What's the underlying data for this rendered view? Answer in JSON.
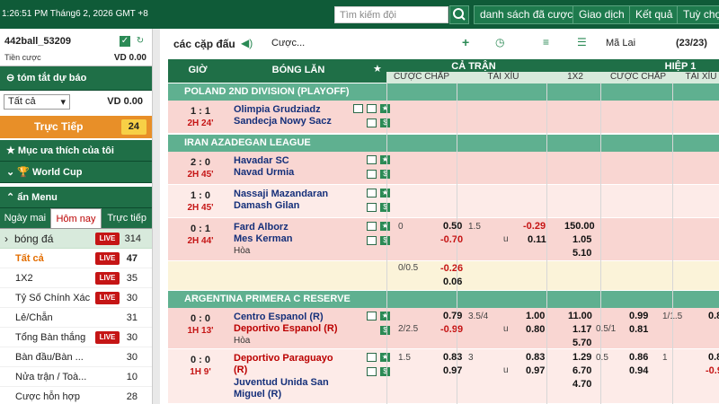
{
  "topbar": {
    "time": "1:26:51 PM Tháng6 2, 2026 GMT +8",
    "search_placeholder": "Tìm kiếm đội",
    "nav": [
      "danh sách đã cược",
      "Giao dịch",
      "Kết quả",
      "Tuỳ chọn"
    ]
  },
  "account": {
    "username": "442ball_53209",
    "bet_label": "Tiền cược",
    "bet_value": "VD  0.00"
  },
  "sidebar": {
    "summary_title": "tóm tắt dự báo",
    "select_value": "Tất cả",
    "summary_value": "VD 0.00",
    "live_label": "Trực Tiếp",
    "live_count": "24",
    "favorites": "Mục ưa thích của tôi",
    "worldcup": "World Cup",
    "hide_menu": "ẩn Menu",
    "tabs": [
      "Ngày mai",
      "Hôm nay",
      "Trực tiếp"
    ],
    "sport": {
      "label": "bóng đá",
      "badge": "LIVE",
      "count": "314"
    },
    "items": [
      {
        "label": "Tất cả",
        "badge": "LIVE",
        "count": "47",
        "active": true
      },
      {
        "label": "1X2",
        "badge": "LIVE",
        "count": "35"
      },
      {
        "label": "Tỷ Số Chính Xác",
        "badge": "LIVE",
        "count": "30"
      },
      {
        "label": "Lẻ/Chẵn",
        "badge": "",
        "count": "31"
      },
      {
        "label": "Tổng Bàn thắng",
        "badge": "LIVE",
        "count": "30"
      },
      {
        "label": "Bàn đầu/Bàn ...",
        "badge": "",
        "count": "30"
      },
      {
        "label": "Nửa trận / Toà...",
        "badge": "",
        "count": "10"
      },
      {
        "label": "Cược hỗn hợp",
        "badge": "",
        "count": "28"
      }
    ]
  },
  "main": {
    "title": "các cặp đấu",
    "bet_label": "Cược...",
    "odds_type": "Mã Lai",
    "count": "(23/23)",
    "columns": {
      "time": "GIỜ",
      "match": "BÓNG LĂN",
      "full_time": "CẢ TRẬN",
      "first_half": "HIỆP 1",
      "handicap": "CƯỢC CHẤP",
      "over_under": "TÀI XỈU",
      "one_x_two": "1X2",
      "handicap2": "CƯỢC CHẤP",
      "over_under2": "TÀI XỈU"
    },
    "leagues": [
      {
        "name": "POLAND 2ND DIVISION (PLAYOFF)"
      },
      {
        "name": "IRAN AZADEGAN LEAGUE"
      },
      {
        "name": "ARGENTINA PRIMERA C RESERVE"
      }
    ],
    "matches": [
      {
        "score": "1 : 1",
        "min": "2H 24'",
        "home": "Olimpia Grudziadz",
        "away": "Sandecja Nowy Sacz"
      },
      {
        "score": "2 : 0",
        "min": "2H 45'",
        "home": "Havadar SC",
        "away": "Navad Urmia"
      },
      {
        "score": "1 : 0",
        "min": "2H 45'",
        "home": "Nassaji Mazandaran",
        "away": "Damash Gilan"
      },
      {
        "score": "0 : 1",
        "min": "2H 44'",
        "home": "Fard Alborz",
        "away": "Mes Kerman",
        "draw": "Hòa",
        "hcap": "0",
        "hcap_home": "0.50",
        "hcap_away": "-0.70",
        "ou": "1.5",
        "ou_u": "u",
        "ou_o": "-0.29",
        "ou_u_val": "0.11",
        "x1": "150.00",
        "x2": "1.05",
        "x3": "5.10",
        "hcap2": "0/0.5",
        "hcap2_home": "-0.26",
        "hcap2_away": "0.06"
      },
      {
        "score": "0 : 0",
        "min": "1H 13'",
        "home": "Centro Espanol (R)",
        "away": "Deportivo Espanol (R)",
        "draw": "Hòa",
        "hcap": "2/2.5",
        "hcap_home": "0.79",
        "hcap_away": "-0.99",
        "ou": "3.5/4",
        "ou_u": "u",
        "ou_o": "1.00",
        "ou_u_val": "0.80",
        "x1": "11.00",
        "x2": "1.17",
        "x3": "5.70",
        "h1_hcap": "0.5/1",
        "h1_home": "0.99",
        "h1_away": "0.81",
        "h1_ou": "1/1.5",
        "h1_o": "0.8"
      },
      {
        "score": "0 : 0",
        "min": "1H 9'",
        "home": "Deportivo Paraguayo (R)",
        "away": "Juventud Unida San Miguel (R)",
        "hcap": "1.5",
        "hcap_home": "0.83",
        "hcap_away": "0.97",
        "ou": "3",
        "ou_u": "u",
        "ou_o": "0.83",
        "ou_u_val": "0.97",
        "x1": "1.29",
        "x2": "6.70",
        "x3": "4.70",
        "h1_hcap": "0.5",
        "h1_home": "0.86",
        "h1_away": "0.94",
        "h1_ou": "1",
        "h1_o": "0.8",
        "h1_o2": "-0.9"
      }
    ]
  }
}
